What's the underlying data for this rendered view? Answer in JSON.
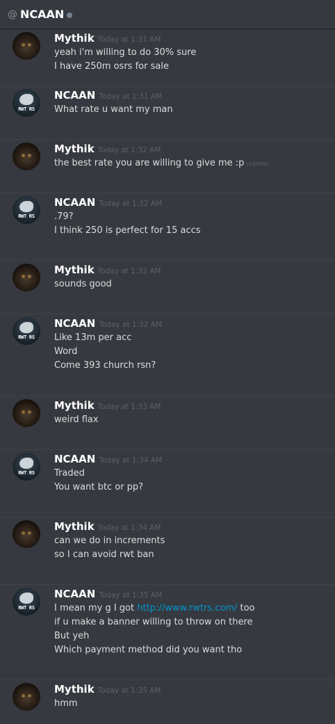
{
  "header": {
    "at_symbol": "@",
    "name": "NCAAN"
  },
  "messages": [
    {
      "author": "Mythik",
      "time": "Today at 1:31 AM",
      "avatar": "mythik",
      "lines": [
        "yeah i'm willing to do 30% sure",
        "I have 250m osrs for sale"
      ]
    },
    {
      "author": "NCAAN",
      "time": "Today at 1:31 AM",
      "avatar": "ncaan",
      "lines": [
        "What rate u want my man"
      ]
    },
    {
      "author": "Mythik",
      "time": "Today at 1:32 AM",
      "avatar": "mythik",
      "lines": [
        "the best rate you are willing to give me :p"
      ],
      "edited": "(edited)"
    },
    {
      "author": "NCAAN",
      "time": "Today at 1:32 AM",
      "avatar": "ncaan",
      "lines": [
        ".79?",
        "I think 250 is perfect for 15 accs"
      ]
    },
    {
      "author": "Mythik",
      "time": "Today at 1:32 AM",
      "avatar": "mythik",
      "lines": [
        "sounds good"
      ]
    },
    {
      "author": "NCAAN",
      "time": "Today at 1:32 AM",
      "avatar": "ncaan",
      "lines": [
        "Like 13m per acc",
        "Word",
        "Come 393 church rsn?"
      ]
    },
    {
      "author": "Mythik",
      "time": "Today at 1:33 AM",
      "avatar": "mythik",
      "lines": [
        "weird flax"
      ]
    },
    {
      "author": "NCAAN",
      "time": "Today at 1:34 AM",
      "avatar": "ncaan",
      "lines": [
        "Traded",
        "You want btc or pp?"
      ]
    },
    {
      "author": "Mythik",
      "time": "Today at 1:34 AM",
      "avatar": "mythik",
      "lines": [
        "can we do in increments",
        "so I can avoid rwt ban"
      ]
    },
    {
      "author": "NCAAN",
      "time": "Today at 1:35 AM",
      "avatar": "ncaan",
      "link_line": {
        "before": "I mean my g I got ",
        "link": "http://www.rwtrs.com/",
        "after": " too"
      },
      "lines": [
        "if u make a banner willing to throw on there",
        "But yeh",
        "Which payment method did you want tho"
      ]
    },
    {
      "author": "Mythik",
      "time": "Today at 1:35 AM",
      "avatar": "mythik",
      "lines": [
        "hmm"
      ]
    }
  ],
  "avatar_text": {
    "ncaan": "RWT RS"
  },
  "colors": {
    "background": "#36393f",
    "link": "#0096cf",
    "author": "#ffffff",
    "timestamp": "#5d6167"
  }
}
